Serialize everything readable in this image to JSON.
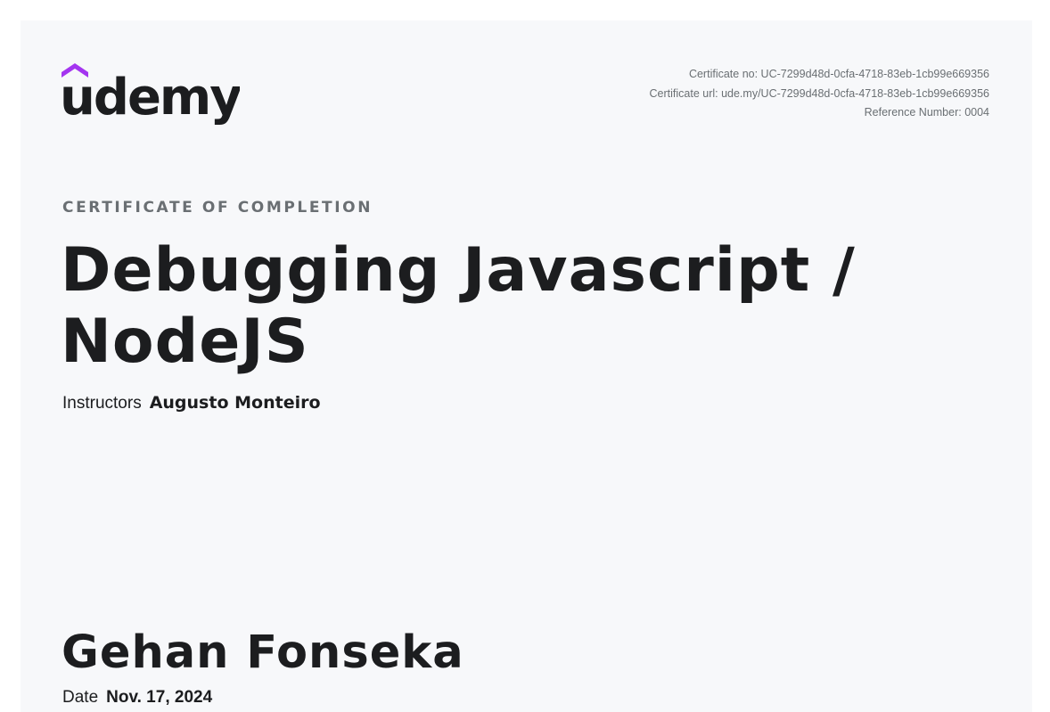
{
  "brand": {
    "logo_text": "udemy",
    "accent_color": "#a435f0",
    "text_color": "#1c1d1f"
  },
  "meta": {
    "certificate_no": "Certificate no: UC-7299d48d-0cfa-4718-83eb-1cb99e669356",
    "certificate_url": "Certificate url: ude.my/UC-7299d48d-0cfa-4718-83eb-1cb99e669356",
    "reference_number": "Reference Number: 0004"
  },
  "certificate": {
    "eyebrow": "CERTIFICATE OF COMPLETION",
    "course_title": "Debugging Javascript / NodeJS",
    "instructors_label": "Instructors",
    "instructors_value": "Augusto Monteiro",
    "recipient_name": "Gehan Fonseka",
    "date_label": "Date",
    "date_value": "Nov. 17, 2024"
  }
}
